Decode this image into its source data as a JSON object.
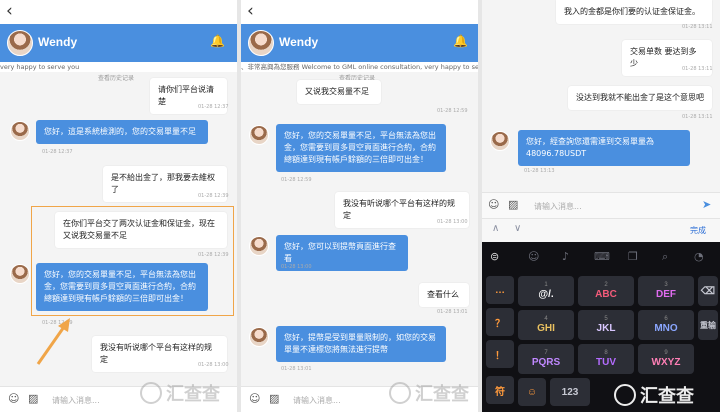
{
  "panel1": {
    "contact": "Wendy",
    "welcome": "very happy to serve you",
    "history": "查看历史记录",
    "messages": [
      {
        "text": "请你们平台说清楚",
        "ts": "01-28 12:37"
      },
      {
        "text": "您好，這是系統檢測的，您的交易單量不足",
        "ts": "01-28 12:37"
      },
      {
        "text": "是不給出金了，那我要去維权了",
        "ts": "01-28 12:39"
      },
      {
        "text": "在你们平台交了两次认证金和保证金，现在又说我交易量不足",
        "ts": "01-28 12:39"
      },
      {
        "text": "您好，您的交易單量不足，平台無法為您出金，您需要到買多買空頁面進行合約，合約總額達到現有帳戶餘額的三倍即可出金！",
        "ts": "01-28 12:39"
      },
      {
        "text": "我没有听说哪个平台有这样的规定",
        "ts": "01-28 13:00"
      }
    ],
    "input_placeholder": "请输入消息..."
  },
  "panel2": {
    "contact": "Wendy",
    "welcome": "、非常高興為您服務 Welcome to GML online consultation, very happy to serve you",
    "history": "查看历史记录",
    "messages": [
      {
        "text": "又说我交易量不足",
        "ts": "01-28 12:59"
      },
      {
        "text": "您好，您的交易單量不足，平台無法為您出金，您需要到買多買空頁面進行合約，合約總額達到現有帳戶餘額的三倍即可出金！",
        "ts": "01-28 12:59"
      },
      {
        "text": "我没有听说哪个平台有这样的规定",
        "ts": "01-28 13:00"
      },
      {
        "text": "您好，您可以到提幣頁面進行查看",
        "ts": "01-28 13:00"
      },
      {
        "text": "查看什么",
        "ts": "01-28 13:01"
      },
      {
        "text": "您好，提幣是受到單量限制的，如您的交易單量不達標您將無法進行提幣",
        "ts": "01-28 13:01"
      }
    ],
    "input_placeholder": "请输入消息..."
  },
  "panel3": {
    "messages": [
      {
        "text": "我入的金都是你们要的认证金保证金。",
        "ts": "01-28 13:11"
      },
      {
        "text": "交易单数 要达到多少",
        "ts": "01-28 13:11"
      },
      {
        "text": "没达到我就不能出金了是这个意思吧",
        "ts": "01-28 13:11"
      },
      {
        "text": "您好，經查詢您還需達到交易單量為48096.78USDT",
        "ts": "01-28 13:13"
      }
    ],
    "input_placeholder": "请输入消息...",
    "done_label": "完成",
    "keys": {
      "row1": [
        "@/.",
        "ABC",
        "DEF"
      ],
      "row2": [
        "GHI",
        "JKL",
        "MNO"
      ],
      "row3": [
        "PQRS",
        "TUV",
        "WXYZ"
      ],
      "row4": [
        "符",
        "123"
      ],
      "nums1": [
        "1",
        "2",
        "3"
      ],
      "nums2": [
        "4",
        "5",
        "6"
      ],
      "nums3": [
        "7",
        "8",
        "9"
      ],
      "redo": "重输"
    }
  },
  "watermark": "汇查查",
  "colors": {
    "header": "#4a8fdf",
    "agent_bubble": "#4a8fdf",
    "highlight": "#f0a548",
    "arrow": "#f0a548"
  }
}
